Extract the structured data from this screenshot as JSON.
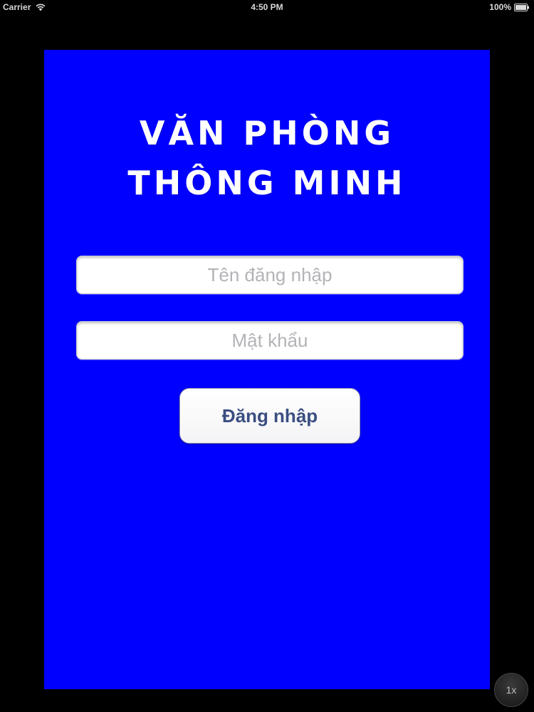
{
  "status_bar": {
    "carrier": "Carrier",
    "time": "4:50 PM",
    "battery": "100%",
    "wifi_icon": "wifi-icon",
    "battery_icon": "battery-icon"
  },
  "login": {
    "title_line1": "VĂN PHÒNG",
    "title_line2": "THÔNG MINH",
    "username_placeholder": "Tên đăng nhập",
    "username_value": "",
    "password_placeholder": "Mật khẩu",
    "password_value": "",
    "login_button_label": "Đăng nhập"
  },
  "zoom": {
    "label": "1x"
  },
  "colors": {
    "panel_background": "#0000ff",
    "screen_background": "#000000",
    "title_text": "#ffffff",
    "button_text": "#3a4e80"
  }
}
